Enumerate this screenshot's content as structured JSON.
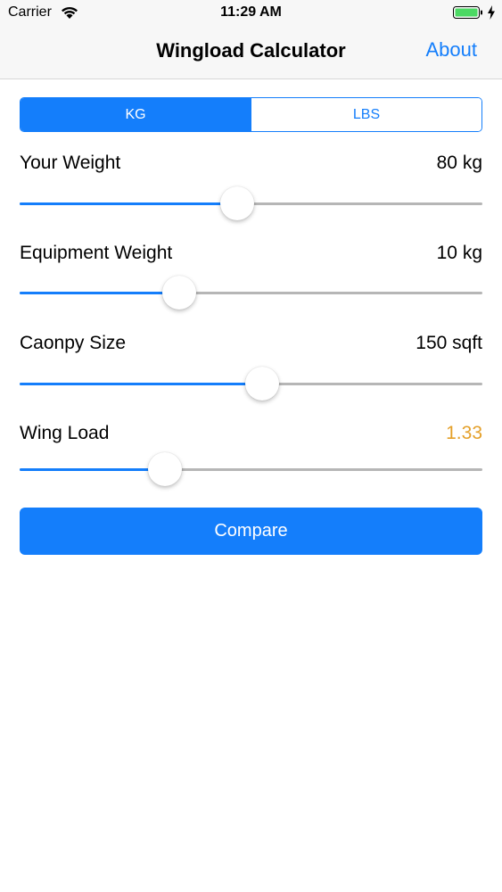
{
  "status_bar": {
    "carrier": "Carrier",
    "time": "11:29 AM",
    "battery_color": "#4cd964"
  },
  "nav": {
    "title": "Wingload Calculator",
    "about_label": "About"
  },
  "unit_toggle": {
    "options": [
      "KG",
      "LBS"
    ],
    "selected": "KG"
  },
  "rows": [
    {
      "label": "Your Weight",
      "value": "80 kg",
      "slider_fraction": 0.47
    },
    {
      "label": "Equipment Weight",
      "value": "10 kg",
      "slider_fraction": 0.345
    },
    {
      "label": "Caonpy Size",
      "value": "150 sqft",
      "slider_fraction": 0.525
    },
    {
      "label": "Wing Load",
      "value": "1.33",
      "slider_fraction": 0.315
    }
  ],
  "compare_label": "Compare",
  "colors": {
    "accent": "#147efb",
    "wing_load_value": "#e4a02a"
  }
}
